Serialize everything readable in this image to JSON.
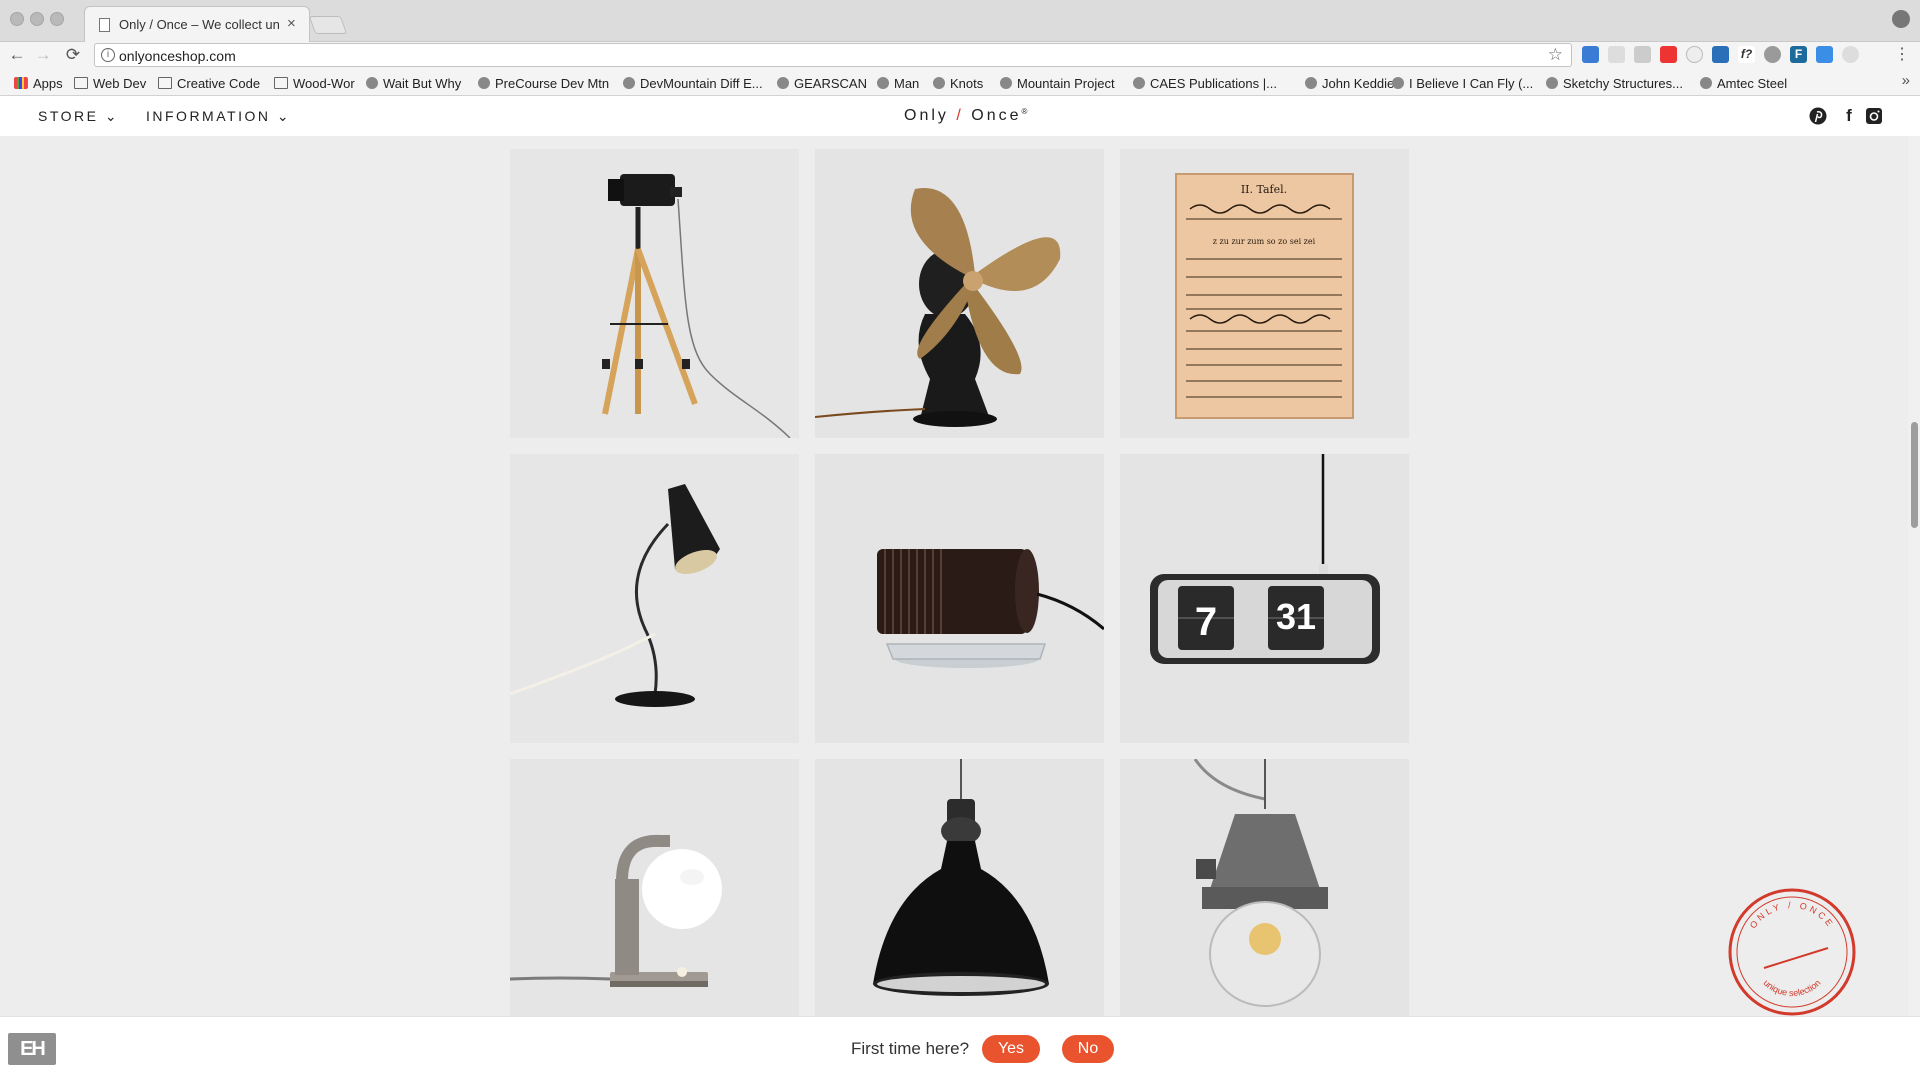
{
  "browser": {
    "tab_title": "Only / Once – We collect uniqu",
    "tab_close": "×",
    "url": "onlyonceshop.com",
    "nav_back": "←",
    "nav_forward": "→",
    "nav_reload": "⟳",
    "bookmarks": [
      {
        "label": "Apps",
        "icon": "apps-grid-icon"
      },
      {
        "label": "Web Dev",
        "icon": "folder-icon"
      },
      {
        "label": "Creative Code",
        "icon": "folder-icon"
      },
      {
        "label": "Wood-Wor",
        "icon": "folder-icon"
      },
      {
        "label": "Wait But Why",
        "icon": "site-icon"
      },
      {
        "label": "PreCourse Dev Mtn",
        "icon": "site-icon"
      },
      {
        "label": "DevMountain Diff E...",
        "icon": "site-icon"
      },
      {
        "label": "GEARSCAN",
        "icon": "site-icon"
      },
      {
        "label": "Man",
        "icon": "site-icon"
      },
      {
        "label": "Knots",
        "icon": "site-icon"
      },
      {
        "label": "Mountain Project",
        "icon": "site-icon"
      },
      {
        "label": "CAES Publications |...",
        "icon": "site-icon"
      },
      {
        "label": "John Keddie",
        "icon": "site-icon"
      },
      {
        "label": "I Believe I Can Fly (...",
        "icon": "site-icon"
      },
      {
        "label": "Sketchy Structures...",
        "icon": "site-icon"
      },
      {
        "label": "Amtec Steel",
        "icon": "site-icon"
      }
    ],
    "bookmarks_more": "»"
  },
  "site": {
    "nav_store": "STORE ⌄",
    "nav_information": "INFORMATION ⌄",
    "logo_only": "Only",
    "logo_slash": "/",
    "logo_once": "Once",
    "logo_mark": "®",
    "social_facebook": "f",
    "accent_color": "#d23a2b"
  },
  "products": [
    {
      "name": "tripod-spotlight"
    },
    {
      "name": "brass-fan"
    },
    {
      "name": "german-script-chart"
    },
    {
      "name": "black-desk-lamp"
    },
    {
      "name": "tubular-heater"
    },
    {
      "name": "flip-clock"
    },
    {
      "name": "chrome-globe-lamp"
    },
    {
      "name": "enamel-pendant-lamp"
    },
    {
      "name": "industrial-cage-lamp"
    }
  ],
  "clock": {
    "hour": "7",
    "minute": "31"
  },
  "chart_text": {
    "line1": "II. Tafel.",
    "line2": "z zu zur zum so zo sei zei"
  },
  "stamp": {
    "top": "ONLY / ONCE",
    "bottom": "unique selection"
  },
  "footer_bar": {
    "logo_text": "EH",
    "prompt": "First time here?",
    "yes": "Yes",
    "no": "No"
  }
}
